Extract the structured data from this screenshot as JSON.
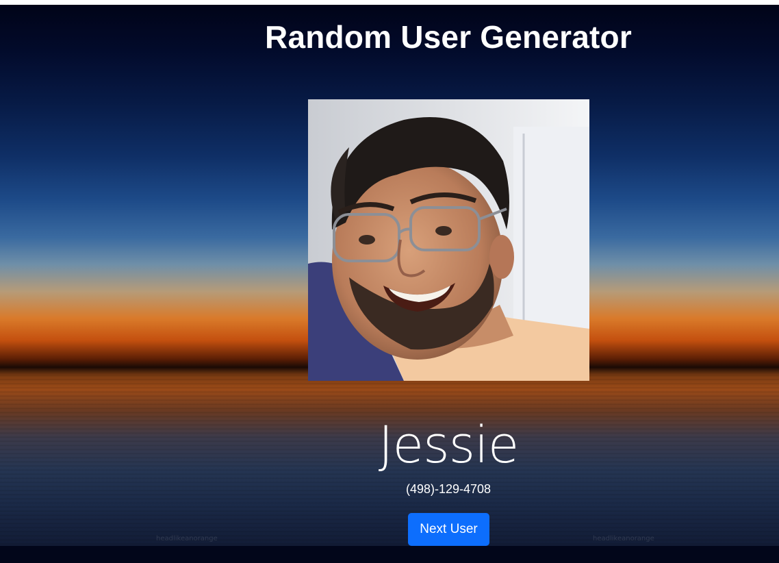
{
  "page": {
    "title": "Random User Generator"
  },
  "user": {
    "name": "Jessie",
    "phone": "(498)-129-4708",
    "photo_alt": "Jessie"
  },
  "actions": {
    "next_label": "Next User"
  },
  "background": {
    "watermark": "headlikeanorange"
  },
  "colors": {
    "button": "#0d6efd",
    "text": "#ffffff",
    "sky_top": "#010418",
    "horizon": "#d97a2a"
  },
  "icons": {
    "user_photo": "person-portrait-photo"
  }
}
